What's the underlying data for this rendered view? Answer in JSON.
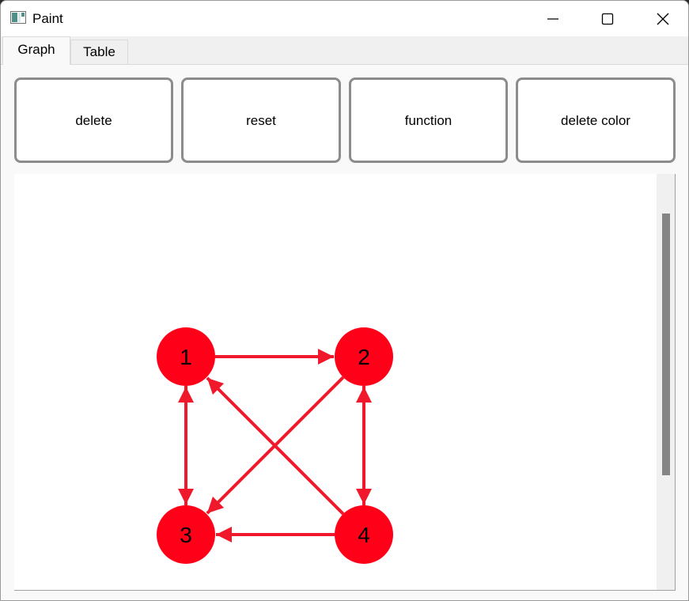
{
  "window": {
    "title": "Paint",
    "icon": "paint-app-icon"
  },
  "titlebar": {
    "minimize_icon": "minimize-icon",
    "maximize_icon": "maximize-icon",
    "close_icon": "close-icon"
  },
  "tabs": [
    {
      "label": "Graph",
      "selected": true
    },
    {
      "label": "Table",
      "selected": false
    }
  ],
  "toolbar": {
    "buttons": [
      {
        "label": "delete"
      },
      {
        "label": "reset"
      },
      {
        "label": "function"
      },
      {
        "label": "delete color"
      }
    ]
  },
  "graph": {
    "node_color": "#ff0019",
    "edge_color": "#f0192b",
    "nodes": [
      {
        "id": 1,
        "label": "1"
      },
      {
        "id": 2,
        "label": "2"
      },
      {
        "id": 3,
        "label": "3"
      },
      {
        "id": 4,
        "label": "4"
      }
    ],
    "edges": [
      {
        "from": 1,
        "to": 2
      },
      {
        "from": 1,
        "to": 3
      },
      {
        "from": 3,
        "to": 1
      },
      {
        "from": 2,
        "to": 4
      },
      {
        "from": 4,
        "to": 2
      },
      {
        "from": 2,
        "to": 3
      },
      {
        "from": 4,
        "to": 1
      },
      {
        "from": 4,
        "to": 3
      }
    ]
  }
}
